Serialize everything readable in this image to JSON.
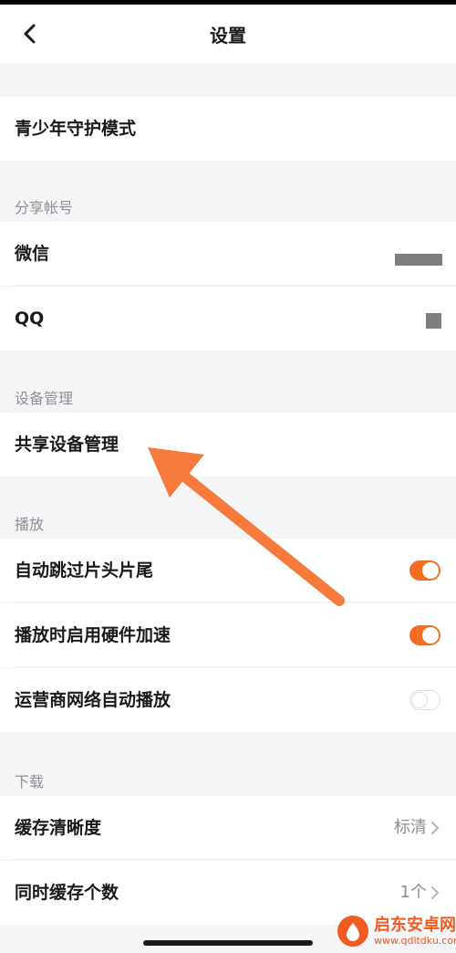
{
  "nav": {
    "title": "设置"
  },
  "items": {
    "teen_mode": "青少年守护模式",
    "wechat": "微信",
    "qq": "QQ",
    "shared_devices": "共享设备管理",
    "auto_skip": "自动跳过片头片尾",
    "hw_accel": "播放时启用硬件加速",
    "carrier_autoplay": "运营商网络自动播放",
    "cache_quality": "缓存清晰度",
    "concurrent_cache": "同时缓存个数"
  },
  "sections": {
    "share_accounts": "分享帐号",
    "device_mgmt": "设备管理",
    "playback": "播放",
    "download": "下载"
  },
  "values": {
    "cache_quality": "标清",
    "concurrent_cache": "1个"
  },
  "toggles": {
    "auto_skip": true,
    "hw_accel": true,
    "carrier_autoplay": false
  },
  "watermark": {
    "name": "启东安卓网",
    "url": "www.qdltdku.com"
  },
  "colors": {
    "accent": "#f36e21",
    "arrow": "#f57a3c"
  }
}
